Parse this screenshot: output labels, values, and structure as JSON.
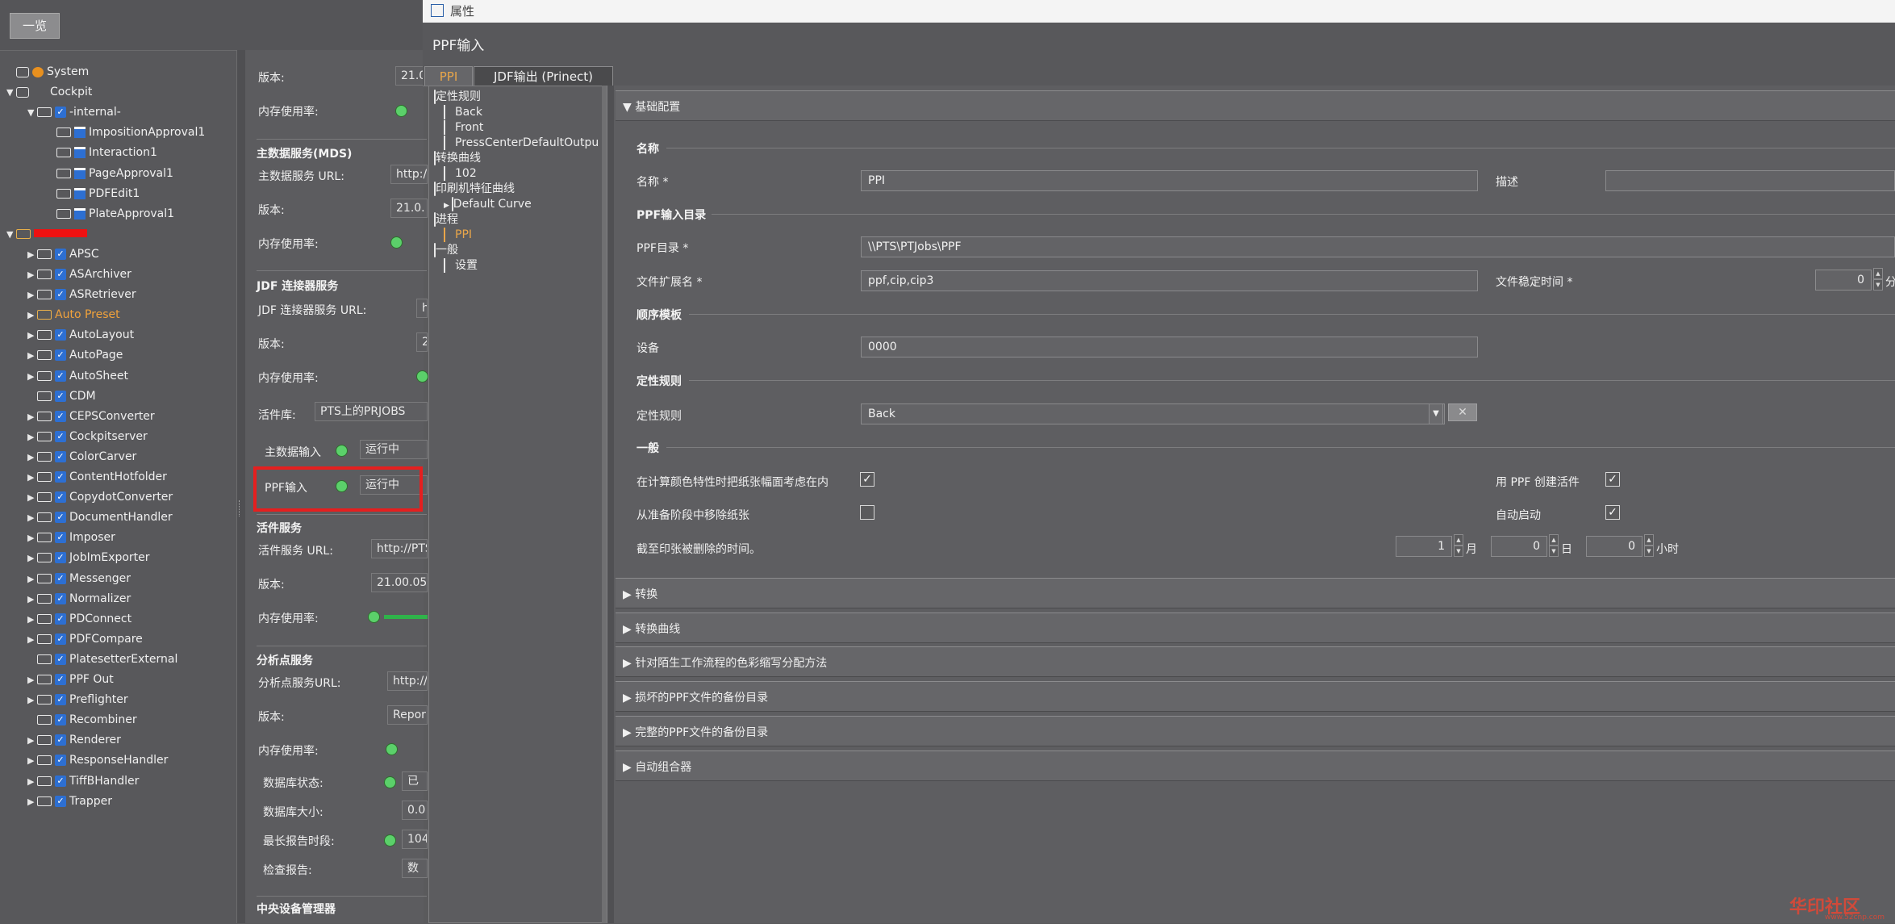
{
  "overview_button": "一览",
  "tree": [
    {
      "label": "System",
      "level": 0,
      "icon": "system-icon",
      "expand": ""
    },
    {
      "label": "Cockpit",
      "level": 0,
      "icon": "server-icon",
      "expand": "▼"
    },
    {
      "label": "-internal-",
      "level": 1,
      "icon": "check-icon",
      "expand": "▼"
    },
    {
      "label": "ImpositionApproval1",
      "level": 2,
      "icon": "doc-icon",
      "expand": ""
    },
    {
      "label": "Interaction1",
      "level": 2,
      "icon": "doc-icon",
      "expand": ""
    },
    {
      "label": "PageApproval1",
      "level": 2,
      "icon": "doc-icon",
      "expand": ""
    },
    {
      "label": "PDFEdit1",
      "level": 2,
      "icon": "doc-icon",
      "expand": ""
    },
    {
      "label": "PlateApproval1",
      "level": 2,
      "icon": "doc-icon",
      "expand": ""
    },
    {
      "label": "",
      "level": 0,
      "icon": "folder-icon",
      "expand": "▼",
      "redacted": true
    },
    {
      "label": "APSC",
      "level": 1,
      "icon": "check-icon",
      "expand": "▶"
    },
    {
      "label": "ASArchiver",
      "level": 1,
      "icon": "check-icon",
      "expand": "▶"
    },
    {
      "label": "ASRetriever",
      "level": 1,
      "icon": "check-icon",
      "expand": "▶"
    },
    {
      "label": "Auto Preset",
      "level": 1,
      "icon": "folder-icon",
      "expand": "▶",
      "orange": true
    },
    {
      "label": "AutoLayout",
      "level": 1,
      "icon": "check-icon",
      "expand": "▶"
    },
    {
      "label": "AutoPage",
      "level": 1,
      "icon": "check-icon",
      "expand": "▶"
    },
    {
      "label": "AutoSheet",
      "level": 1,
      "icon": "check-icon",
      "expand": "▶"
    },
    {
      "label": "CDM",
      "level": 1,
      "icon": "check-icon",
      "expand": ""
    },
    {
      "label": "CEPSConverter",
      "level": 1,
      "icon": "check-icon",
      "expand": "▶"
    },
    {
      "label": "Cockpitserver",
      "level": 1,
      "icon": "check-icon",
      "expand": "▶"
    },
    {
      "label": "ColorCarver",
      "level": 1,
      "icon": "check-icon",
      "expand": "▶"
    },
    {
      "label": "ContentHotfolder",
      "level": 1,
      "icon": "check-icon",
      "expand": "▶"
    },
    {
      "label": "CopydotConverter",
      "level": 1,
      "icon": "check-icon",
      "expand": "▶"
    },
    {
      "label": "DocumentHandler",
      "level": 1,
      "icon": "check-icon",
      "expand": "▶"
    },
    {
      "label": "Imposer",
      "level": 1,
      "icon": "check-icon",
      "expand": "▶"
    },
    {
      "label": "JobImExporter",
      "level": 1,
      "icon": "check-icon",
      "expand": "▶"
    },
    {
      "label": "Messenger",
      "level": 1,
      "icon": "check-icon",
      "expand": "▶"
    },
    {
      "label": "Normalizer",
      "level": 1,
      "icon": "check-icon",
      "expand": "▶"
    },
    {
      "label": "PDConnect",
      "level": 1,
      "icon": "check-icon",
      "expand": "▶"
    },
    {
      "label": "PDFCompare",
      "level": 1,
      "icon": "check-icon",
      "expand": "▶"
    },
    {
      "label": "PlatesetterExternal",
      "level": 1,
      "icon": "check-icon",
      "expand": ""
    },
    {
      "label": "PPF Out",
      "level": 1,
      "icon": "check-icon",
      "expand": "▶"
    },
    {
      "label": "Preflighter",
      "level": 1,
      "icon": "check-icon",
      "expand": "▶"
    },
    {
      "label": "Recombiner",
      "level": 1,
      "icon": "check-icon",
      "expand": ""
    },
    {
      "label": "Renderer",
      "level": 1,
      "icon": "check-icon",
      "expand": "▶"
    },
    {
      "label": "ResponseHandler",
      "level": 1,
      "icon": "check-icon",
      "expand": "▶"
    },
    {
      "label": "TiffBHandler",
      "level": 1,
      "icon": "check-icon",
      "expand": "▶"
    },
    {
      "label": "Trapper",
      "level": 1,
      "icon": "check-icon",
      "expand": "▶"
    }
  ],
  "status": {
    "version_label": "版本:",
    "memory_label": "内存使用率:",
    "version_1": "21.0",
    "mds_header": "主数据服务(MDS)",
    "mds_url_label": "主数据服务 URL:",
    "mds_url": "http:/",
    "mds_version": "21.0.",
    "jdf_header": "JDF 连接器服务",
    "jdf_url_label": "JDF 连接器服务 URL:",
    "jdf_url": "h",
    "jdf_version": "2",
    "store_label": "活件库:",
    "store_value": "PTS上的PRJOBS",
    "mdi_label": "主数据输入",
    "mdi_state": "运行中",
    "ppf_label": "PPF输入",
    "ppf_state": "运行中",
    "job_header": "活件服务",
    "job_url_label": "活件服务 URL:",
    "job_url": "http://PTS",
    "job_version": "21.00.05",
    "ana_header": "分析点服务",
    "ana_url_label": "分析点服务URL:",
    "ana_url": "http://",
    "ana_version": "Repor",
    "db_state_label": "数据库状态:",
    "db_state": "已",
    "db_size_label": "数据库大小:",
    "db_size": "0.0",
    "max_report_label": "最长报告时段:",
    "max_report": "104",
    "check_report_label": "检查报告:",
    "check_report": "数",
    "cdm_header": "中央设备管理器"
  },
  "window": {
    "title": "属性",
    "header": "PPF输入",
    "tab_ppi": "PPI",
    "tab_jdf": "JDF输出 (Prinect)"
  },
  "itree": [
    {
      "label": "定性规则",
      "level": 0,
      "kind": "folder"
    },
    {
      "label": "Back",
      "level": 1,
      "kind": "box"
    },
    {
      "label": "Front",
      "level": 1,
      "kind": "box"
    },
    {
      "label": "PressCenterDefaultOutpu",
      "level": 1,
      "kind": "box"
    },
    {
      "label": "转换曲线",
      "level": 0,
      "kind": "folder"
    },
    {
      "label": "102",
      "level": 1,
      "kind": "box"
    },
    {
      "label": "印刷机特征曲线",
      "level": 0,
      "kind": "folder"
    },
    {
      "label": "Default Curve",
      "level": 1,
      "kind": "folderarrow"
    },
    {
      "label": "进程",
      "level": 0,
      "kind": "folder"
    },
    {
      "label": "PPI",
      "level": 1,
      "kind": "boxorange"
    },
    {
      "label": "一般",
      "level": 0,
      "kind": "folder"
    },
    {
      "label": "设置",
      "level": 1,
      "kind": "box"
    }
  ],
  "form": {
    "basic_config": "基础配置",
    "name_group": "名称",
    "name_label": "名称 *",
    "name_value": "PPI",
    "desc_label": "描述",
    "ppf_dir_group": "PPF输入目录",
    "ppf_dir_label": "PPF目录 *",
    "ppf_dir_value": "\\\\PTS\\PTJobs\\PPF",
    "ext_label": "文件扩展名 *",
    "ext_value": "ppf,cip,cip3",
    "stable_label": "文件稳定时间 *",
    "stable_value": "0",
    "stable_unit": "分",
    "order_group": "顺序模板",
    "device_label": "设备",
    "device_value": "0000",
    "rule_group": "定性规则",
    "rule_label": "定性规则",
    "rule_value": "Back",
    "x_button": "✕",
    "general_group": "一般",
    "cb1_label": "在计算颜色特性时把纸张幅面考虑在内",
    "cb2_label": "从准备阶段中移除纸张",
    "cb3_label": "用 PPF 创建活件",
    "cb4_label": "自动启动",
    "expire_label": "截至印张被删除的时间。",
    "month_value": "1",
    "month_unit": "月",
    "day_value": "0",
    "day_unit": "日",
    "hour_value": "0",
    "hour_unit": "小时",
    "sections": [
      "转换",
      "转换曲线",
      "针对陌生工作流程的色彩缩写分配方法",
      "损坏的PPF文件的备份目录",
      "完整的PPF文件的备份目录",
      "自动组合器"
    ]
  },
  "checkboxes": {
    "cb1": true,
    "cb2": false,
    "cb3": true,
    "cb4": true
  },
  "watermark": "华印社区",
  "watermark_sub": "www.52cnp.com",
  "colors": {
    "accent_orange": "#e9a64a",
    "ok_green": "#5bd06a",
    "highlight_red": "#e51f1f"
  }
}
